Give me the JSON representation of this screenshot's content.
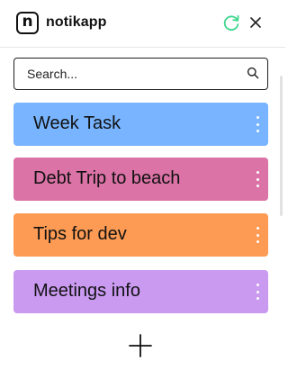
{
  "app": {
    "logo_letter": "n",
    "name": "notikapp"
  },
  "colors": {
    "refresh_icon": "#3dd68c",
    "text": "#111111"
  },
  "search": {
    "value": "",
    "placeholder": "Search..."
  },
  "notes": [
    {
      "title": "Week Task",
      "color": "#78b4ff"
    },
    {
      "title": "Debt Trip to beach",
      "color": "#db73a6"
    },
    {
      "title": "Tips for dev",
      "color": "#fd9b54"
    },
    {
      "title": "Meetings info",
      "color": "#c99af0"
    }
  ],
  "icons": {
    "refresh": "refresh-icon",
    "close": "close-icon",
    "search": "search-icon",
    "more": "kebab-menu-icon",
    "add": "plus-icon"
  }
}
